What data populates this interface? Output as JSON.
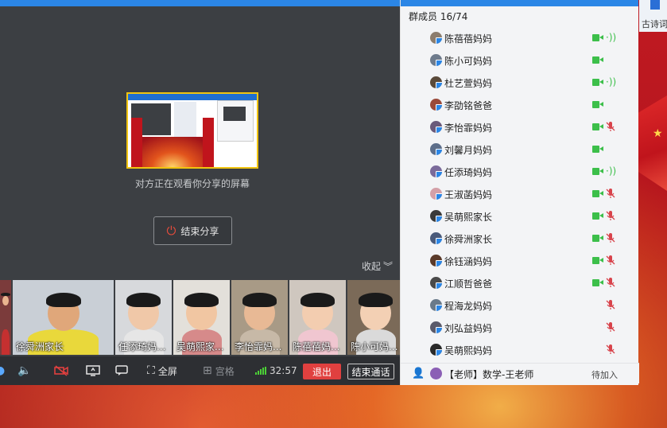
{
  "desktop": {
    "icon_label": "古诗词"
  },
  "share": {
    "caption": "对方正在观看你分享的屏幕",
    "stop_label": "结束分享",
    "collapse_label": "收起"
  },
  "video_strip": [
    {
      "name": "",
      "bg": "#7b3b3b",
      "face": "#e9b48f",
      "shirt": "#c53030"
    },
    {
      "name": "徐舜洲家长",
      "bg": "#c9cfd6",
      "face": "#e0a77a",
      "shirt": "#e9d83b"
    },
    {
      "name": "任添琦妈...",
      "bg": "#d7d9dc",
      "face": "#f0c8a8",
      "shirt": "#e6e6e6"
    },
    {
      "name": "吴萌熙家...",
      "bg": "#e3e0da",
      "face": "#f1c6a2",
      "shirt": "#d68a8a"
    },
    {
      "name": "李怡霏妈...",
      "bg": "#a89a86",
      "face": "#e8b995",
      "shirt": "#c7b9a7"
    },
    {
      "name": "陈蓓蓓妈...",
      "bg": "#cfc7bf",
      "face": "#f3cdb0",
      "shirt": "#f0c6d0"
    },
    {
      "name": "陈小可妈...",
      "bg": "#7b6a58",
      "face": "#f3d0b4",
      "shirt": "#dadada"
    }
  ],
  "toolbar": {
    "fullscreen_label": "全屏",
    "grid_label": "宫格",
    "timer": "32:57",
    "exit_label": "退出",
    "end_call_label": "结束通话"
  },
  "panel": {
    "title": "群成员 16/74",
    "members": [
      {
        "name": "陈蓓蓓妈妈",
        "camera": true,
        "mic": "speaking"
      },
      {
        "name": "陈小可妈妈",
        "camera": true,
        "mic": "none"
      },
      {
        "name": "杜艺萱妈妈",
        "camera": true,
        "mic": "speaking"
      },
      {
        "name": "李劭铭爸爸",
        "camera": true,
        "mic": "none"
      },
      {
        "name": "李怡霏妈妈",
        "camera": true,
        "mic": "muted"
      },
      {
        "name": "刘馨月妈妈",
        "camera": true,
        "mic": "none"
      },
      {
        "name": "任添琦妈妈",
        "camera": true,
        "mic": "speaking"
      },
      {
        "name": "王淑菡妈妈",
        "camera": true,
        "mic": "muted"
      },
      {
        "name": "吴萌熙家长",
        "camera": true,
        "mic": "muted"
      },
      {
        "name": "徐舜洲家长",
        "camera": true,
        "mic": "muted"
      },
      {
        "name": "徐钰涵妈妈",
        "camera": true,
        "mic": "muted"
      },
      {
        "name": "江顺哲爸爸",
        "camera": true,
        "mic": "muted"
      },
      {
        "name": "程海龙妈妈",
        "camera": false,
        "mic": "muted"
      },
      {
        "name": "刘弘益妈妈",
        "camera": false,
        "mic": "muted"
      },
      {
        "name": "吴萌熙妈妈",
        "camera": false,
        "mic": "muted"
      }
    ],
    "teacher": {
      "name": "【老师】数学-王老师",
      "status": "待加入"
    }
  },
  "colors": {
    "accent": "#2b86e6",
    "exit": "#e0403f",
    "camera_on": "#3cbf4a",
    "mic_muted": "#d8434b",
    "highlight_border": "#f1c40f"
  }
}
